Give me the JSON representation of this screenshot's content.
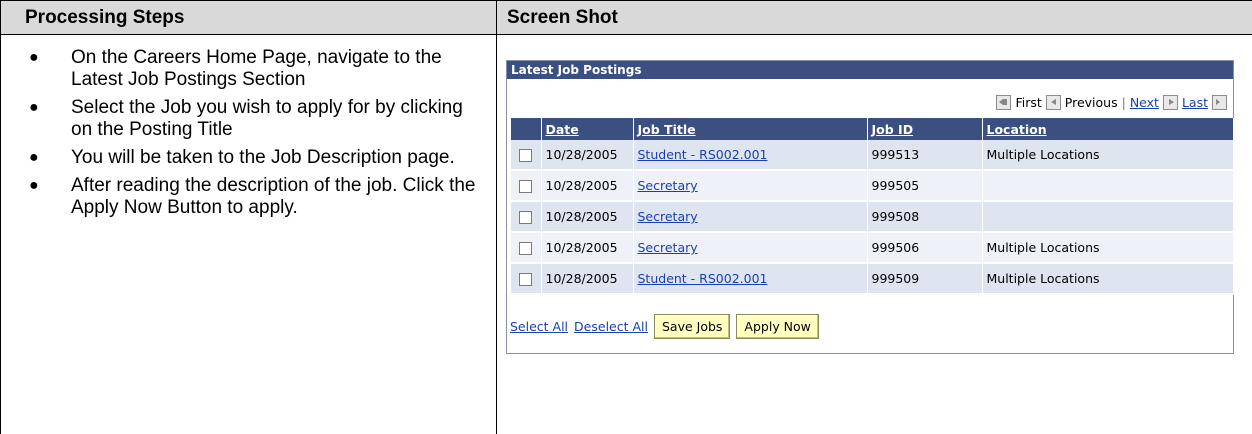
{
  "doc": {
    "headers": [
      "Processing Steps",
      "Screen Shot"
    ],
    "steps": [
      "On the Careers Home Page, navigate to the Latest Job Postings Section",
      "Select the Job you wish to apply for by clicking on the Posting Title",
      "You will be taken to the Job Description page.",
      "After reading the description of the job. Click the Apply Now Button to apply."
    ]
  },
  "panel": {
    "title": "Latest Job Postings",
    "nav": {
      "first": "First",
      "previous": "Previous",
      "next": "Next",
      "last": "Last"
    },
    "columns": [
      "Date",
      "Job Title",
      "Job ID",
      "Location"
    ],
    "rows": [
      {
        "date": "10/28/2005",
        "title": "Student - RS002.001",
        "job_id": "999513",
        "location": "Multiple Locations"
      },
      {
        "date": "10/28/2005",
        "title": "Secretary",
        "job_id": "999505",
        "location": ""
      },
      {
        "date": "10/28/2005",
        "title": "Secretary",
        "job_id": "999508",
        "location": ""
      },
      {
        "date": "10/28/2005",
        "title": "Secretary",
        "job_id": "999506",
        "location": "Multiple Locations"
      },
      {
        "date": "10/28/2005",
        "title": "Student - RS002.001",
        "job_id": "999509",
        "location": "Multiple Locations"
      }
    ],
    "select_all": "Select All",
    "deselect_all": "Deselect All",
    "save_jobs": "Save Jobs",
    "apply_now": "Apply Now"
  }
}
